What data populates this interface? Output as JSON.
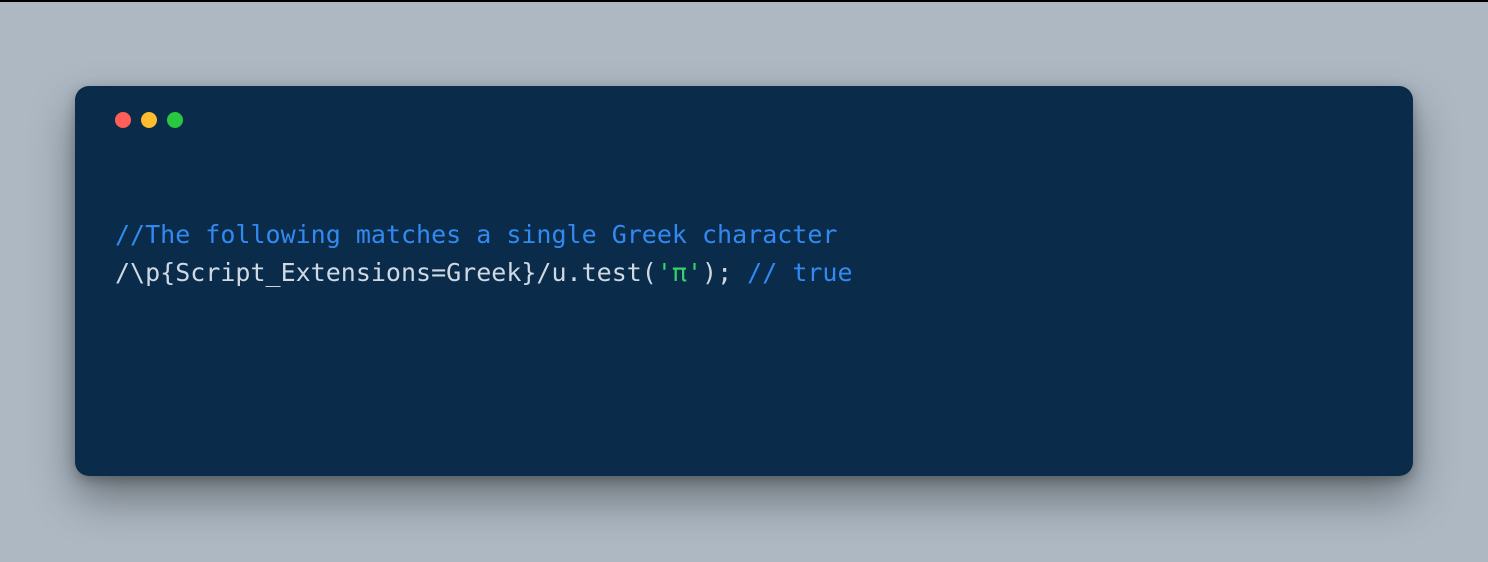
{
  "colors": {
    "page_bg": "#adb8c3",
    "window_bg": "#0a2b4a",
    "traffic_close": "#ff5f57",
    "traffic_min": "#febc2e",
    "traffic_max": "#28c840",
    "comment": "#328af1",
    "default": "#cfd9e4",
    "string": "#35d46a"
  },
  "code": {
    "line1": {
      "comment": "//The following matches a single Greek character"
    },
    "line2": {
      "regex": "/\\p{Script_Extensions=Greek}/u",
      "after_regex": ".test(",
      "string": "'π'",
      "after_string": "); ",
      "trailing_comment": "// true"
    }
  }
}
